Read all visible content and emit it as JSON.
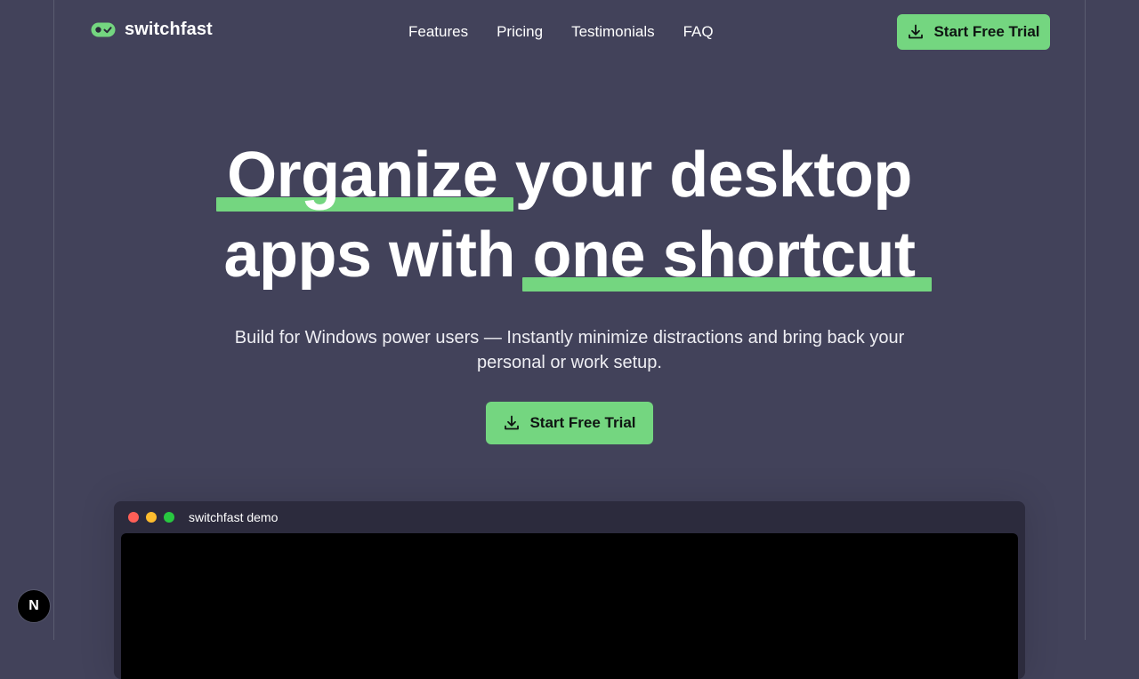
{
  "brand": {
    "name": "switchfast"
  },
  "nav": {
    "links": [
      "Features",
      "Pricing",
      "Testimonials",
      "FAQ"
    ],
    "cta": "Start Free Trial"
  },
  "hero": {
    "line1_highlight": "Organize",
    "line1_rest": "your desktop",
    "line2_start": "apps with",
    "line2_highlight": "one shortcut",
    "subtitle": "Build for Windows power users — Instantly minimize distractions and bring back your personal or work setup.",
    "cta": "Start Free Trial"
  },
  "demo": {
    "title": "switchfast demo"
  },
  "dev_badge": {
    "letter": "N"
  },
  "colors": {
    "background": "#42425a",
    "accent": "#74d680",
    "window": "#2c2b3d",
    "screen": "#000000"
  },
  "icons": {
    "logo": "toggle-check-icon",
    "cta": "download-icon",
    "badge": "nextjs-icon"
  }
}
